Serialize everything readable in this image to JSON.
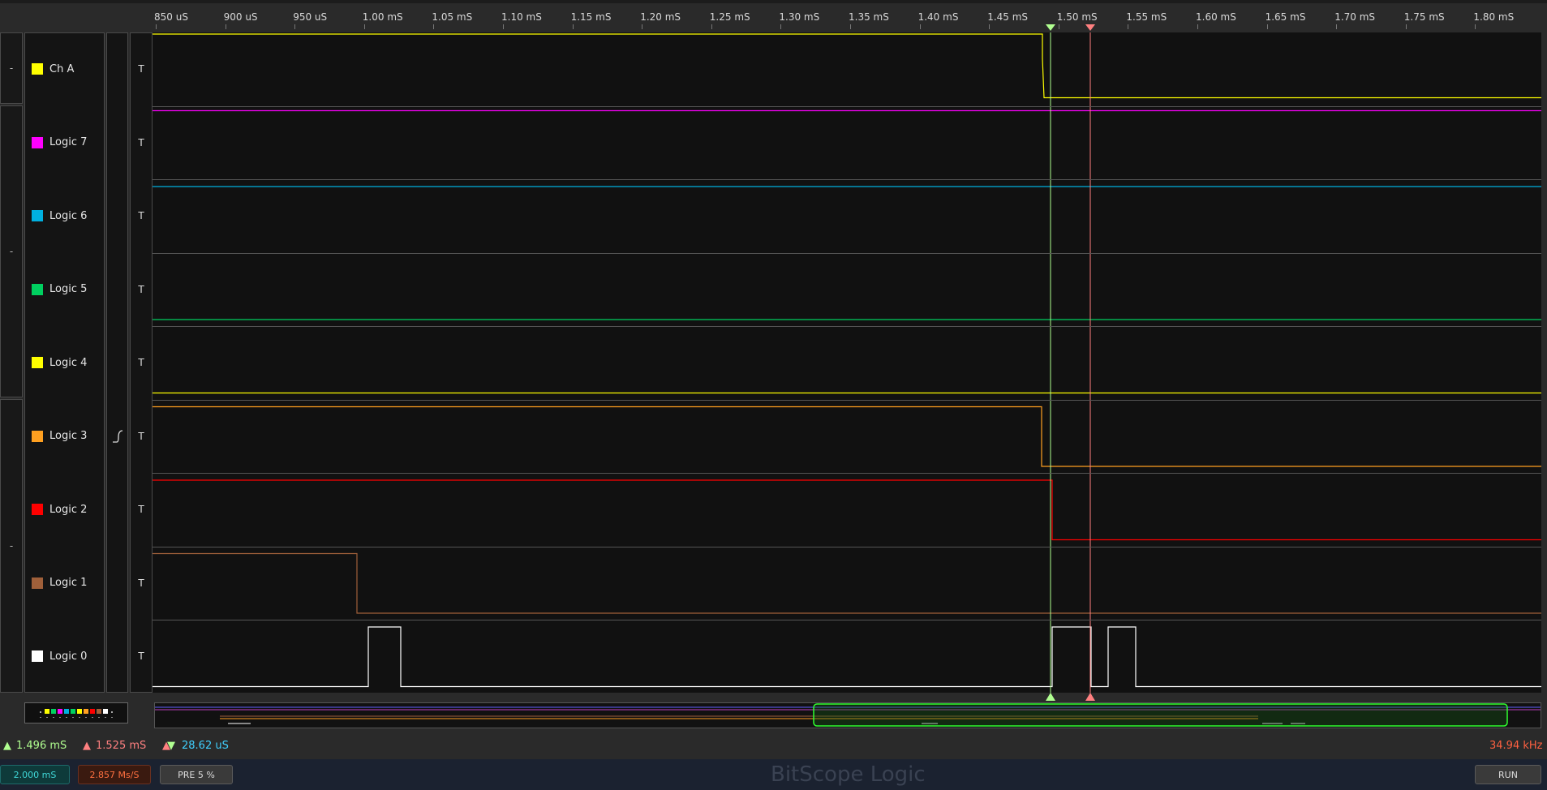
{
  "ruler": {
    "ticks": [
      "850 uS",
      "900 uS",
      "950 uS",
      "1.00 mS",
      "1.05 mS",
      "1.10 mS",
      "1.15 mS",
      "1.20 mS",
      "1.25 mS",
      "1.30 mS",
      "1.35 mS",
      "1.40 mS",
      "1.45 mS",
      "1.50 mS",
      "1.55 mS",
      "1.60 mS",
      "1.65 mS",
      "1.70 mS",
      "1.75 mS",
      "1.80 mS"
    ]
  },
  "groups": [
    {
      "label": "-"
    },
    {
      "label": "-"
    },
    {
      "label": "-"
    }
  ],
  "channels": [
    {
      "name": "Ch A",
      "color": "#ffff00",
      "trigger_mode": "T",
      "edge_icon": ""
    },
    {
      "name": "Logic 7",
      "color": "#ff00ff",
      "trigger_mode": "T",
      "edge_icon": ""
    },
    {
      "name": "Logic 6",
      "color": "#00b0e0",
      "trigger_mode": "T",
      "edge_icon": ""
    },
    {
      "name": "Logic 5",
      "color": "#00d060",
      "trigger_mode": "T",
      "edge_icon": ""
    },
    {
      "name": "Logic 4",
      "color": "#ffff00",
      "trigger_mode": "T",
      "edge_icon": ""
    },
    {
      "name": "Logic 3",
      "color": "#ffa020",
      "trigger_mode": "T",
      "edge_icon": "rising-edge-icon"
    },
    {
      "name": "Logic 2",
      "color": "#ff0000",
      "trigger_mode": "T",
      "edge_icon": ""
    },
    {
      "name": "Logic 1",
      "color": "#a0603a",
      "trigger_mode": "T",
      "edge_icon": ""
    },
    {
      "name": "Logic 0",
      "color": "#ffffff",
      "trigger_mode": "T",
      "edge_icon": ""
    }
  ],
  "markers": {
    "cursor_a": {
      "time": "1.496 mS",
      "color": "#b0ff90"
    },
    "cursor_b": {
      "time": "1.525 mS",
      "color": "#ff8080"
    },
    "delta": "28.62 uS",
    "frequency": "34.94 kHz"
  },
  "controls": {
    "timebase": "2.000 mS",
    "sample_rate": "2.857 Ms/S",
    "pretrigger": "PRE 5 %",
    "run_label": "RUN",
    "app_title": "BitScope Logic"
  }
}
